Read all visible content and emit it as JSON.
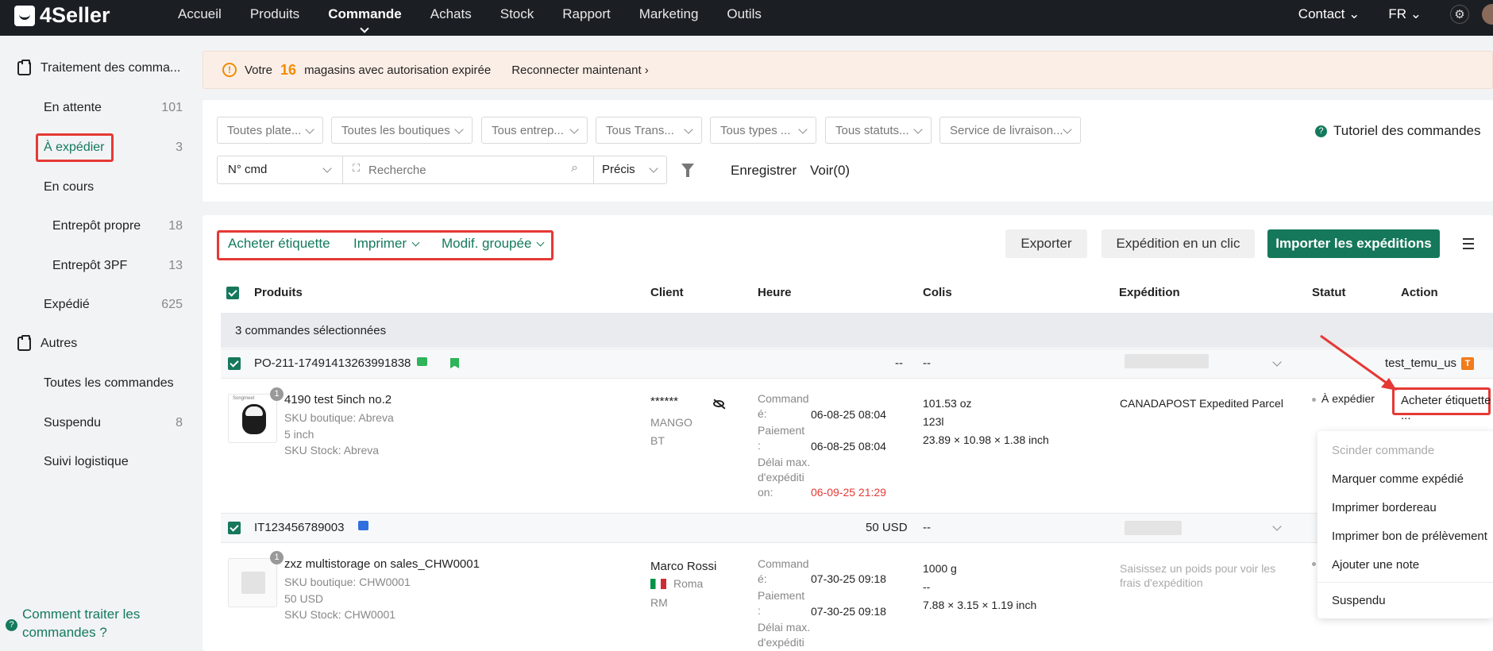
{
  "header": {
    "logo": "4Seller",
    "nav": [
      "Accueil",
      "Produits",
      "Commande",
      "Achats",
      "Stock",
      "Rapport",
      "Marketing",
      "Outils"
    ],
    "contact": "Contact",
    "lang": "FR"
  },
  "sidebar": {
    "group1": "Traitement des comma...",
    "items": [
      {
        "label": "En attente",
        "count": "101"
      },
      {
        "label": "À expédier",
        "count": "3"
      },
      {
        "label": "En cours",
        "count": ""
      },
      {
        "label": "Entrepôt propre",
        "count": "18"
      },
      {
        "label": "Entrepôt 3PF",
        "count": "13"
      },
      {
        "label": "Expédié",
        "count": "625"
      }
    ],
    "group2": "Autres",
    "items2": [
      {
        "label": "Toutes les commandes",
        "count": ""
      },
      {
        "label": "Suspendu",
        "count": "8"
      },
      {
        "label": "Suivi logistique",
        "count": ""
      }
    ],
    "help_line1": "Comment traiter les",
    "help_line2": "commandes ?"
  },
  "banner": {
    "prefix": "Votre",
    "count": "16",
    "suffix": "magasins avec autorisation expirée",
    "link": "Reconnecter maintenant"
  },
  "filters": {
    "selects": [
      "Toutes plate...",
      "Toutes les boutiques",
      "Tous entrep...",
      "Tous Trans...",
      "Tous types ...",
      "Tous statuts...",
      "Service de livraison..."
    ],
    "tutorial": "Tutoriel des commandes",
    "search_field": "N° cmd",
    "search_placeholder": "Recherche",
    "match": "Précis",
    "save": "Enregistrer",
    "view": "Voir(0)"
  },
  "toolbar": {
    "buy_label": "Acheter étiquette",
    "print": "Imprimer",
    "bulk_edit": "Modif. groupée",
    "export": "Exporter",
    "one_click": "Expédition en un clic",
    "import": "Importer les expéditions"
  },
  "table": {
    "headers": [
      "Produits",
      "Client",
      "Heure",
      "Colis",
      "Expédition",
      "Statut",
      "Action"
    ],
    "selected_count": "3",
    "selected_text": "commandes sélectionnées",
    "orders": [
      {
        "id": "PO-211-17491413263991838",
        "amount": "--",
        "colis_head": "--",
        "store": "test_temu_us",
        "store_badge": "T",
        "badge": "1",
        "thumb_brand": "Songmeet",
        "product": "4190 test 5inch no.2",
        "sku_shop": "SKU boutique: Abreva",
        "variant": "5 inch",
        "sku_stock": "SKU Stock: Abreva",
        "client_name": "******",
        "client_city": "MANGO",
        "client_region": "BT",
        "time_lines": [
          "Command",
          "é:",
          "Paiement",
          ":",
          "Délai max.",
          "d'expéditi",
          "on:"
        ],
        "time_ordered": "06-08-25 08:04",
        "time_paid": "06-08-25 08:04",
        "time_deadline": "06-09-25 21:29",
        "colis": [
          "101.53 oz",
          "123l",
          "23.89 × 10.98 × 1.38 inch"
        ],
        "shipping": "CANADAPOST Expedited Parcel",
        "status": "À expédier",
        "action": "Acheter étiquette",
        "more": "..."
      },
      {
        "id": "IT123456789003",
        "amount": "50 USD",
        "colis_head": "--",
        "badge": "1",
        "product": "zxz multistorage on sales_CHW0001",
        "sku_shop": "SKU boutique: CHW0001",
        "variant": "50 USD",
        "sku_stock": "SKU Stock: CHW0001",
        "client_name": "Marco Rossi",
        "client_city": "Roma",
        "client_region": "RM",
        "time_lines": [
          "Command",
          "é:",
          "Paiement",
          ":",
          "Délai max.",
          "d'expéditi"
        ],
        "time_ordered": "07-30-25 09:18",
        "time_paid": "07-30-25 09:18",
        "colis": [
          "1000 g",
          "--",
          "7.88 × 3.15 × 1.19 inch"
        ],
        "shipping_hint": [
          "Saisissez un poids pour voir les",
          "frais d'expédition"
        ]
      }
    ]
  },
  "dropdown": [
    "Scinder commande",
    "Marquer comme expédié",
    "Imprimer bordereau",
    "Imprimer bon de prélèvement",
    "Ajouter une note",
    "Suspendu"
  ]
}
